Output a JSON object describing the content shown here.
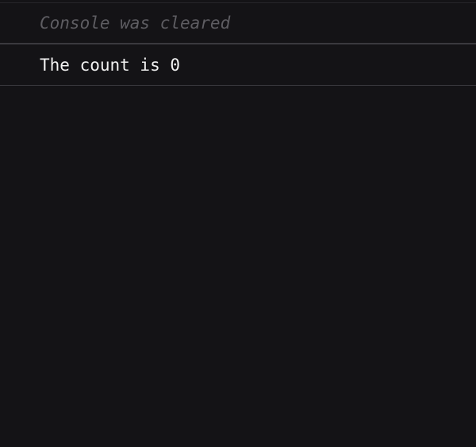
{
  "console": {
    "messages": [
      {
        "type": "info",
        "text": "Console was cleared"
      },
      {
        "type": "log",
        "text": "The count is 0"
      }
    ]
  },
  "colors": {
    "background": "#141316",
    "cleared_text": "#5e5d62",
    "log_text": "#f2f2f2",
    "divider": "#3a393e"
  }
}
